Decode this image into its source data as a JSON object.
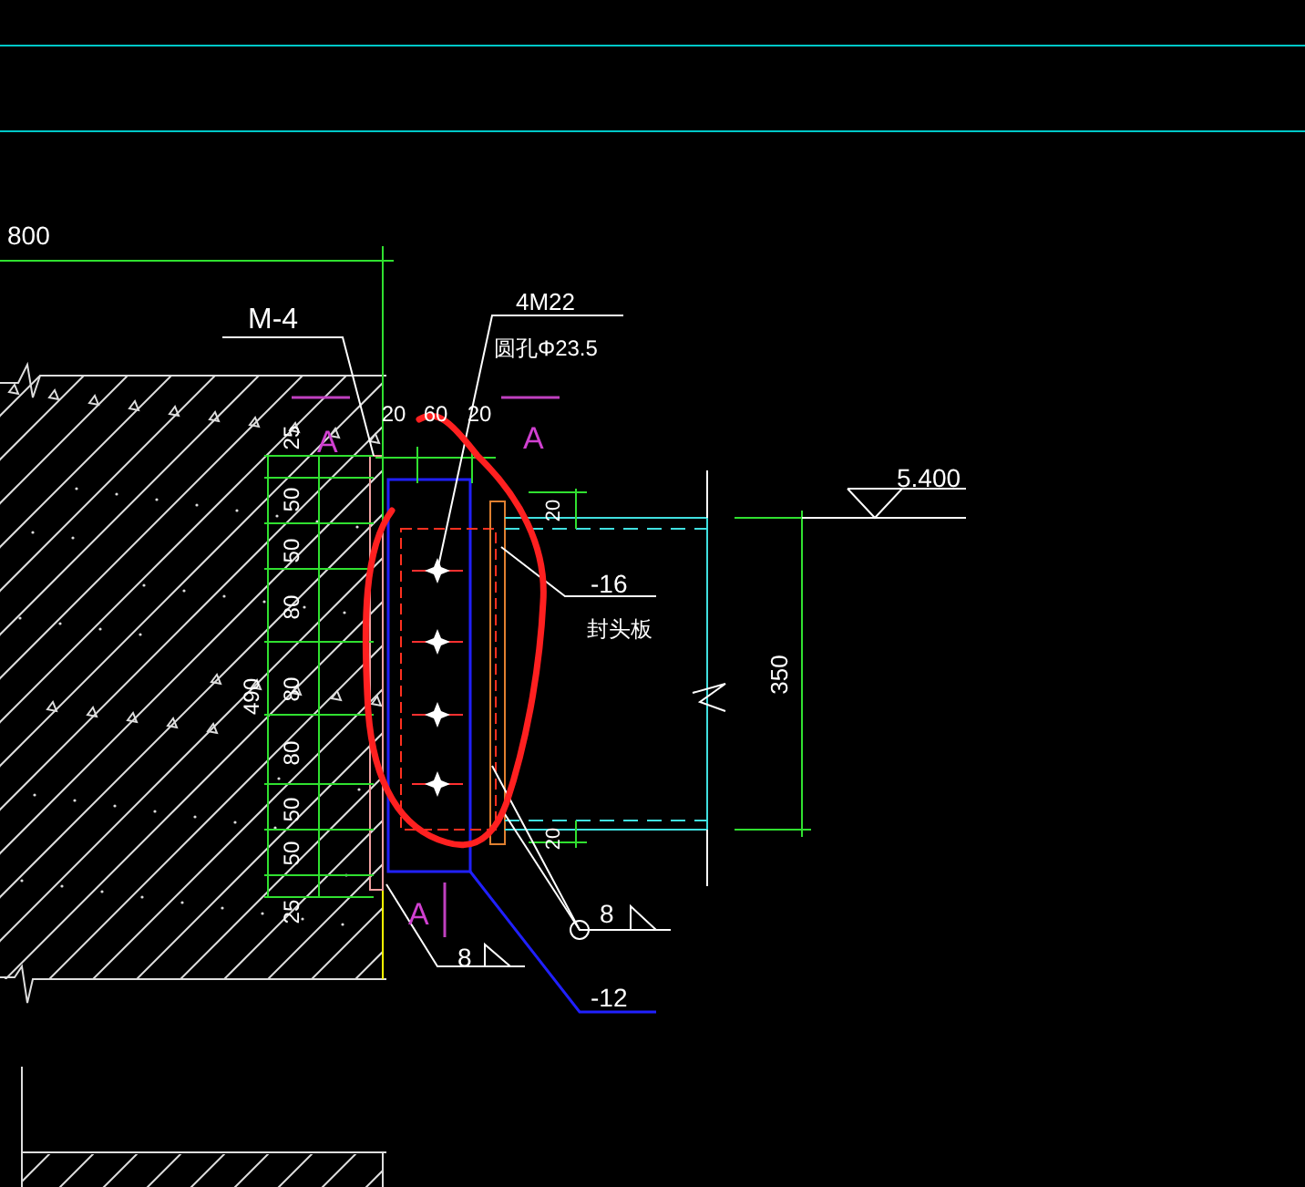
{
  "drawing": {
    "labels": [
      {
        "text": "800",
        "kind": "dimension"
      },
      {
        "text": "M-4",
        "kind": "note"
      },
      {
        "text": "4M22",
        "kind": "note"
      },
      {
        "text": "圆孔Φ23.5",
        "kind": "note"
      },
      {
        "text": "A",
        "kind": "section"
      },
      {
        "text": "A",
        "kind": "section"
      },
      {
        "text": "20",
        "kind": "dimension"
      },
      {
        "text": "60",
        "kind": "dimension"
      },
      {
        "text": "20",
        "kind": "dimension"
      },
      {
        "text": "25",
        "kind": "dimension"
      },
      {
        "text": "50",
        "kind": "dimension"
      },
      {
        "text": "50",
        "kind": "dimension"
      },
      {
        "text": "80",
        "kind": "dimension"
      },
      {
        "text": "490",
        "kind": "dimension"
      },
      {
        "text": "80",
        "kind": "dimension"
      },
      {
        "text": "80",
        "kind": "dimension"
      },
      {
        "text": "50",
        "kind": "dimension"
      },
      {
        "text": "50",
        "kind": "dimension"
      },
      {
        "text": "25",
        "kind": "dimension"
      },
      {
        "text": "20",
        "kind": "dimension"
      },
      {
        "text": "-16",
        "kind": "note"
      },
      {
        "text": "封头板",
        "kind": "note"
      },
      {
        "text": "350",
        "kind": "dimension"
      },
      {
        "text": "5.400",
        "kind": "note"
      },
      {
        "text": "20",
        "kind": "dimension"
      },
      {
        "text": "A",
        "kind": "section"
      },
      {
        "text": "8",
        "kind": "note"
      },
      {
        "text": "8",
        "kind": "note"
      },
      {
        "text": "-12",
        "kind": "note"
      }
    ]
  }
}
